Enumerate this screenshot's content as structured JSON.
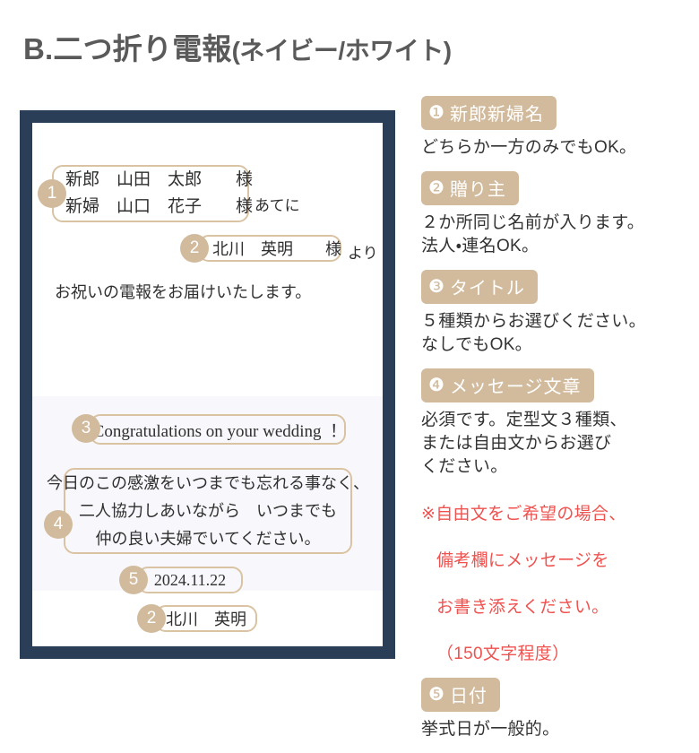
{
  "page": {
    "title_main": "B.二つ折り電報",
    "title_paren": "(ネイビー/ホワイト)"
  },
  "colors": {
    "navy": "#2b3e58",
    "tan": "#d2bb9d",
    "tan_border": "#d9c3a3",
    "red_note": "#ef5350",
    "card_lower_bg": "#f8f8fc"
  },
  "card": {
    "names": {
      "badge": "1",
      "line1": "新郎　山田　太郎　　様",
      "line2": "新婦　山口　花子　　様",
      "suffix": "あてに"
    },
    "sender": {
      "badge": "2",
      "text": "北川　英明　　様",
      "suffix": "より"
    },
    "greeting": "お祝いの電報をお届けいたします。",
    "title": {
      "badge": "3",
      "text": "Congratulations on your wedding ！"
    },
    "message": {
      "badge": "4",
      "line1": "今日のこの感激をいつまでも忘れる事なく、",
      "line2": "二人協力しあいながら　いつまでも",
      "line3": "仲の良い夫婦でいてください。"
    },
    "date": {
      "badge": "5",
      "text": "2024.11.22"
    },
    "signature": {
      "badge": "2",
      "text": "北川　英明"
    }
  },
  "legend": {
    "sections": [
      {
        "circle": "❶",
        "heading": "新郎新婦名",
        "body": "どちらか一方のみでもOK。",
        "note": ""
      },
      {
        "circle": "❷",
        "heading": "贈り主",
        "body": "２か所同じ名前が入ります。\n法人・連名OK。",
        "note": ""
      },
      {
        "circle": "❸",
        "heading": "タイトル",
        "body": "５種類からお選びください。\nなしでもOK。",
        "note": ""
      },
      {
        "circle": "❹",
        "heading": "メッセージ文章",
        "body": "必須です。定型文３種類、\nまたは自由文からお選び\nください。",
        "note_line1": "※自由文をご希望の場合、",
        "note_line2": "備考欄にメッセージを",
        "note_line3": "お書き添えください。",
        "note_line4": "（150文字程度）"
      },
      {
        "circle": "❺",
        "heading": "日付",
        "body": "挙式日が一般的。",
        "note": ""
      }
    ]
  }
}
